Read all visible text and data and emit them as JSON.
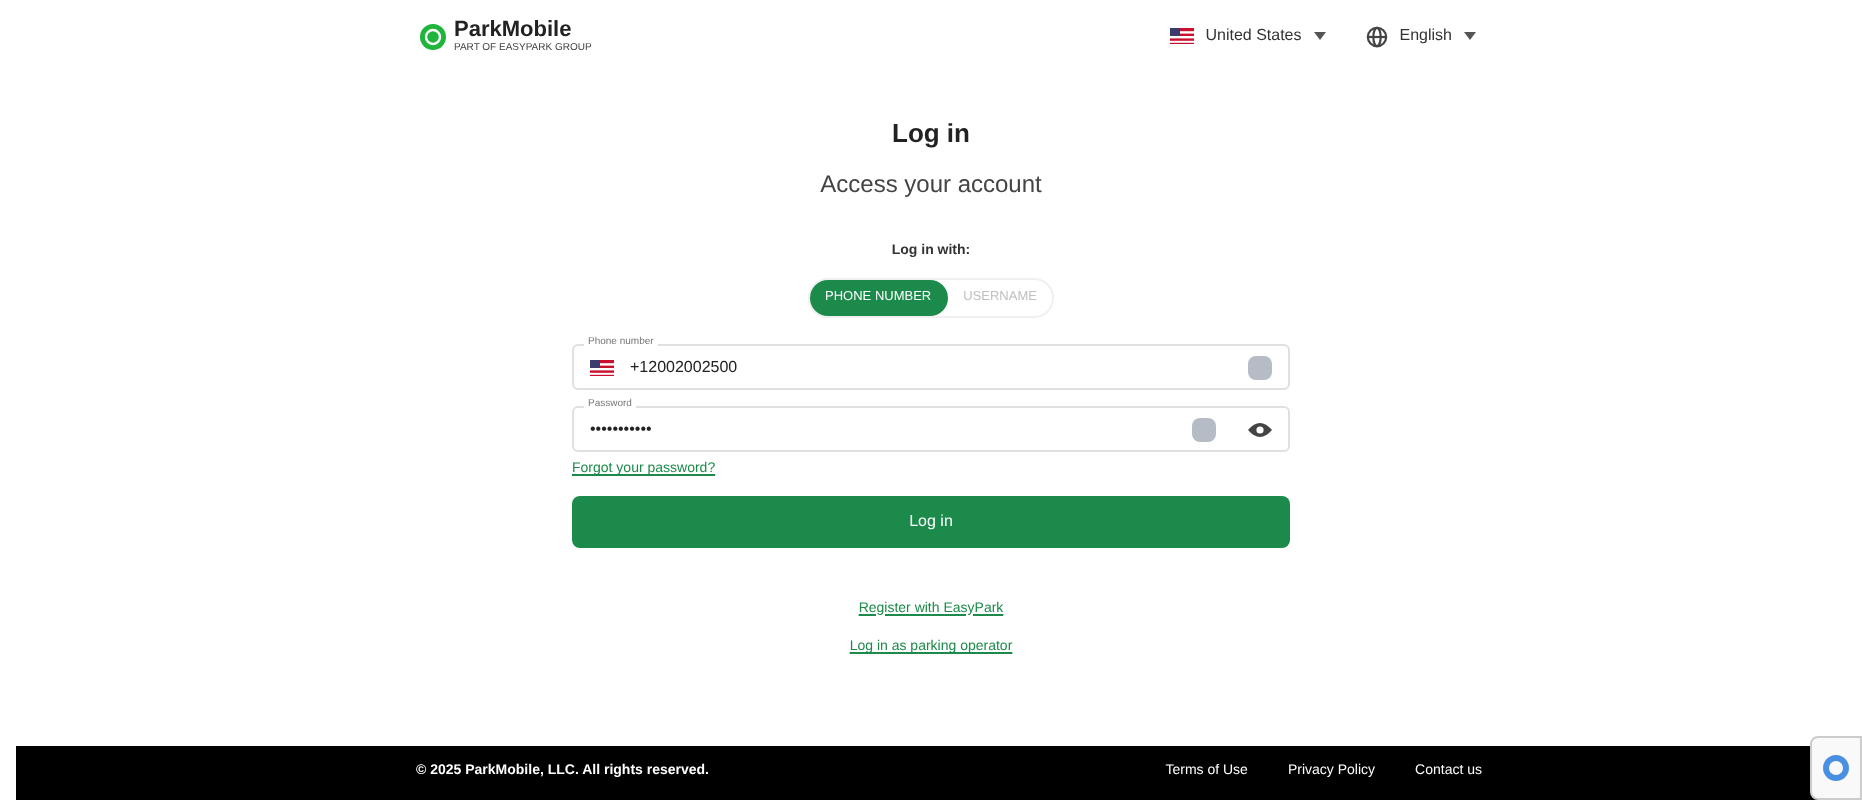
{
  "header": {
    "logo": "ParkMobile",
    "tagline": "PART OF EASYPARK GROUP",
    "country": "United States",
    "language": "English"
  },
  "title": "Log in",
  "subtitle": "Access your account",
  "login_with": "Log in with:",
  "tabs": [
    {
      "label": "PHONE NUMBER",
      "selected": true
    },
    {
      "label": "USERNAME",
      "selected": false
    }
  ],
  "fields": [
    {
      "kind": "phone",
      "label": "Phone number",
      "value": "+12002002500"
    },
    {
      "kind": "password",
      "label": "Password",
      "value": "•••••••••••"
    }
  ],
  "forgot_link": "Forgot your password?",
  "login_button": "Log in",
  "links": [
    "Register with EasyPark",
    "Log in as parking operator"
  ],
  "footer": {
    "copyright": "© 2025 ParkMobile, LLC. All rights reserved.",
    "links": [
      "Terms of Use",
      "Privacy Policy",
      "Contact us"
    ]
  }
}
